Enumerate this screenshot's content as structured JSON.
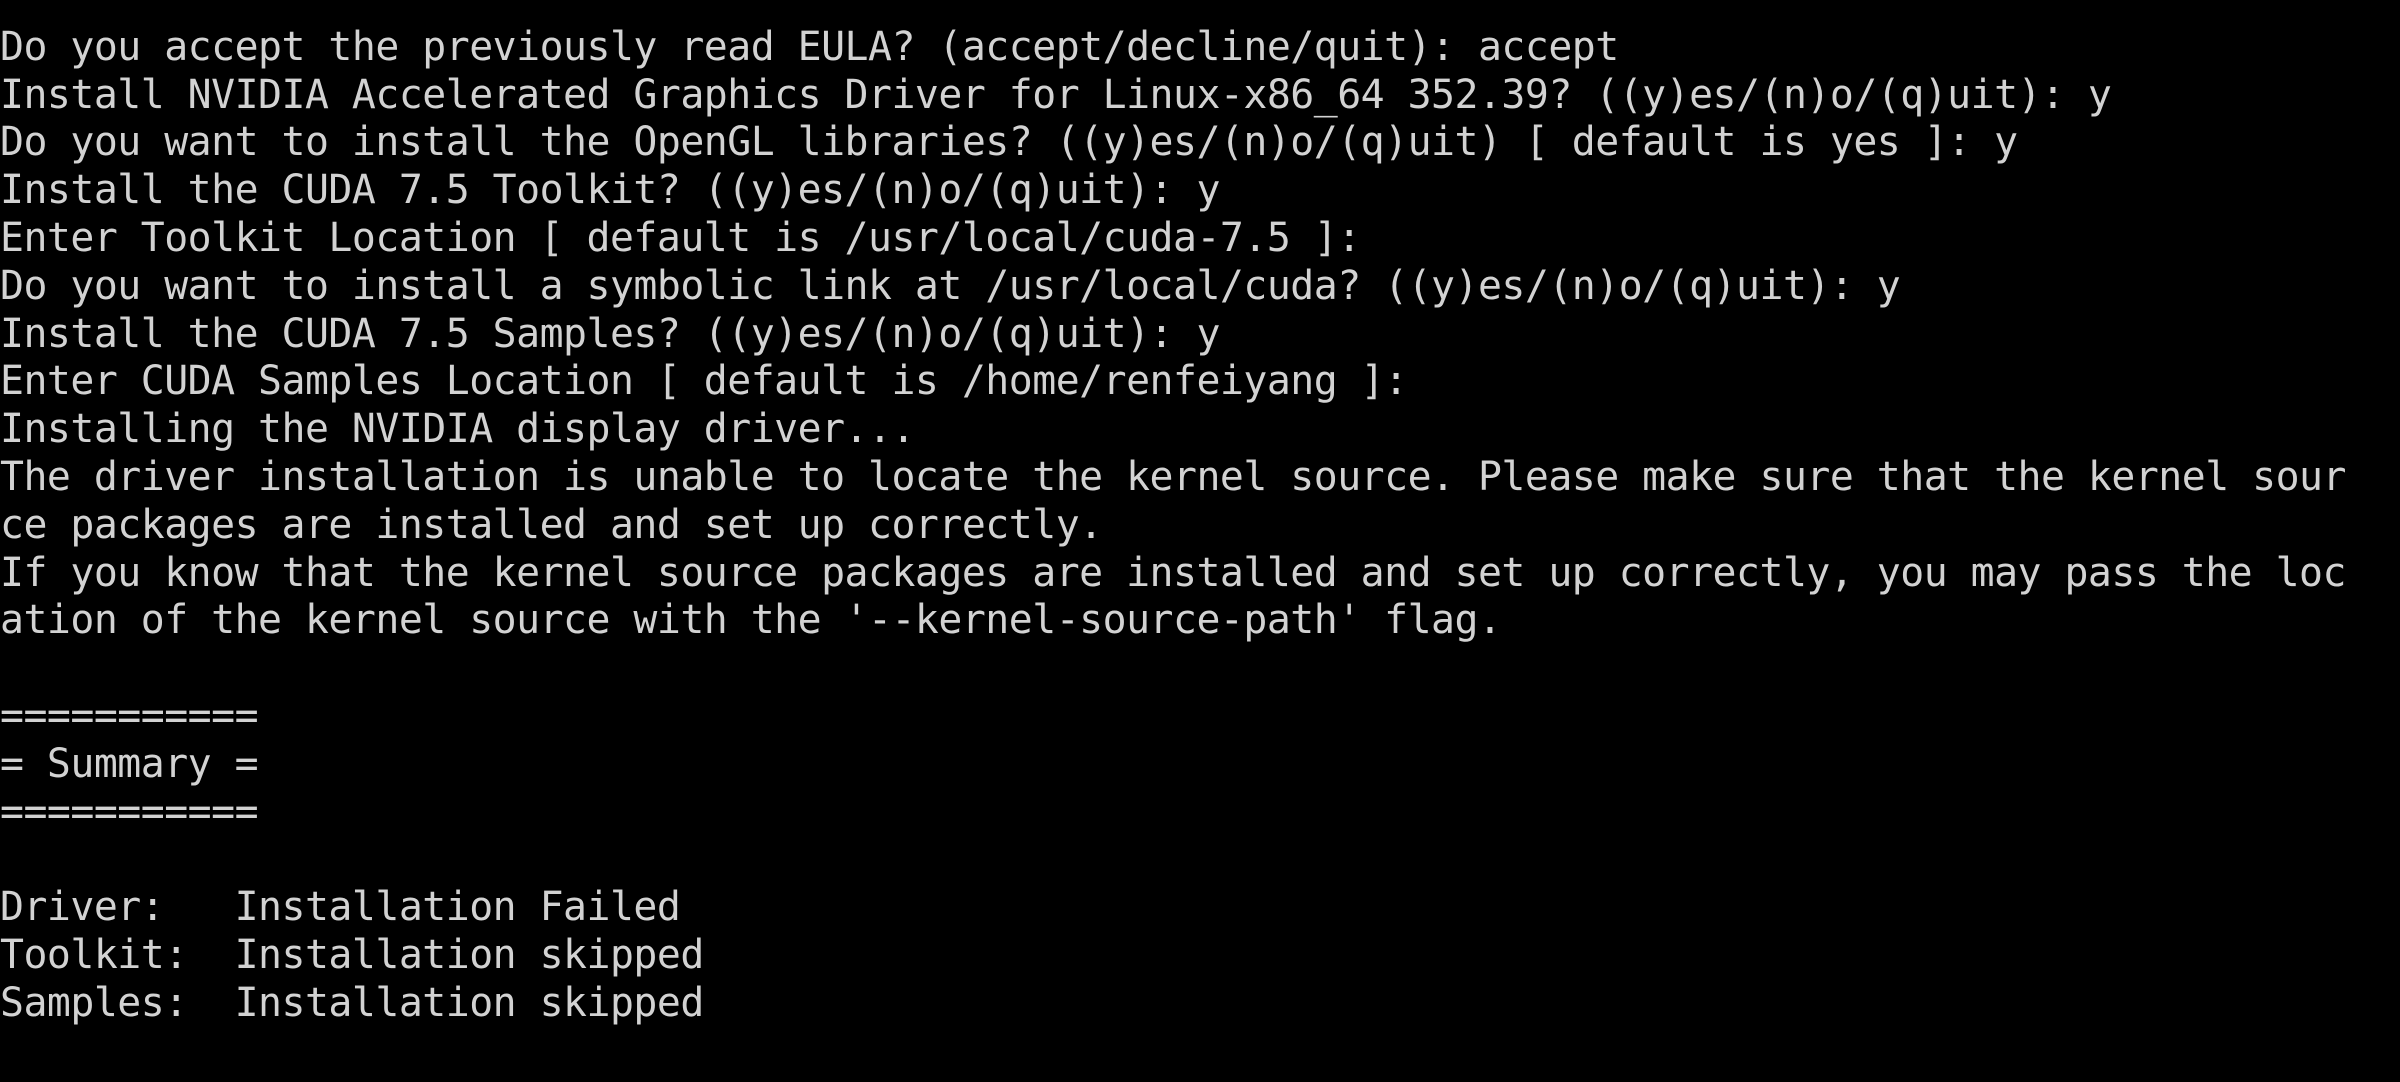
{
  "terminal": {
    "top_rule": "-------------------------------------------------------------",
    "lines": [
      "Do you accept the previously read EULA? (accept/decline/quit): accept",
      "Install NVIDIA Accelerated Graphics Driver for Linux-x86_64 352.39? ((y)es/(n)o/(q)uit): y",
      "Do you want to install the OpenGL libraries? ((y)es/(n)o/(q)uit) [ default is yes ]: y",
      "Install the CUDA 7.5 Toolkit? ((y)es/(n)o/(q)uit): y",
      "Enter Toolkit Location [ default is /usr/local/cuda-7.5 ]:",
      "Do you want to install a symbolic link at /usr/local/cuda? ((y)es/(n)o/(q)uit): y",
      "Install the CUDA 7.5 Samples? ((y)es/(n)o/(q)uit): y",
      "Enter CUDA Samples Location [ default is /home/renfeiyang ]:",
      "Installing the NVIDIA display driver...",
      "The driver installation is unable to locate the kernel source. Please make sure that the kernel sour",
      "ce packages are installed and set up correctly.",
      "If you know that the kernel source packages are installed and set up correctly, you may pass the loc",
      "ation of the kernel source with the '--kernel-source-path' flag."
    ],
    "summary": {
      "rule": "===========",
      "title": "= Summary =",
      "driver": "Driver:   Installation Failed",
      "toolkit": "Toolkit:  Installation skipped",
      "samples": "Samples:  Installation skipped"
    }
  }
}
